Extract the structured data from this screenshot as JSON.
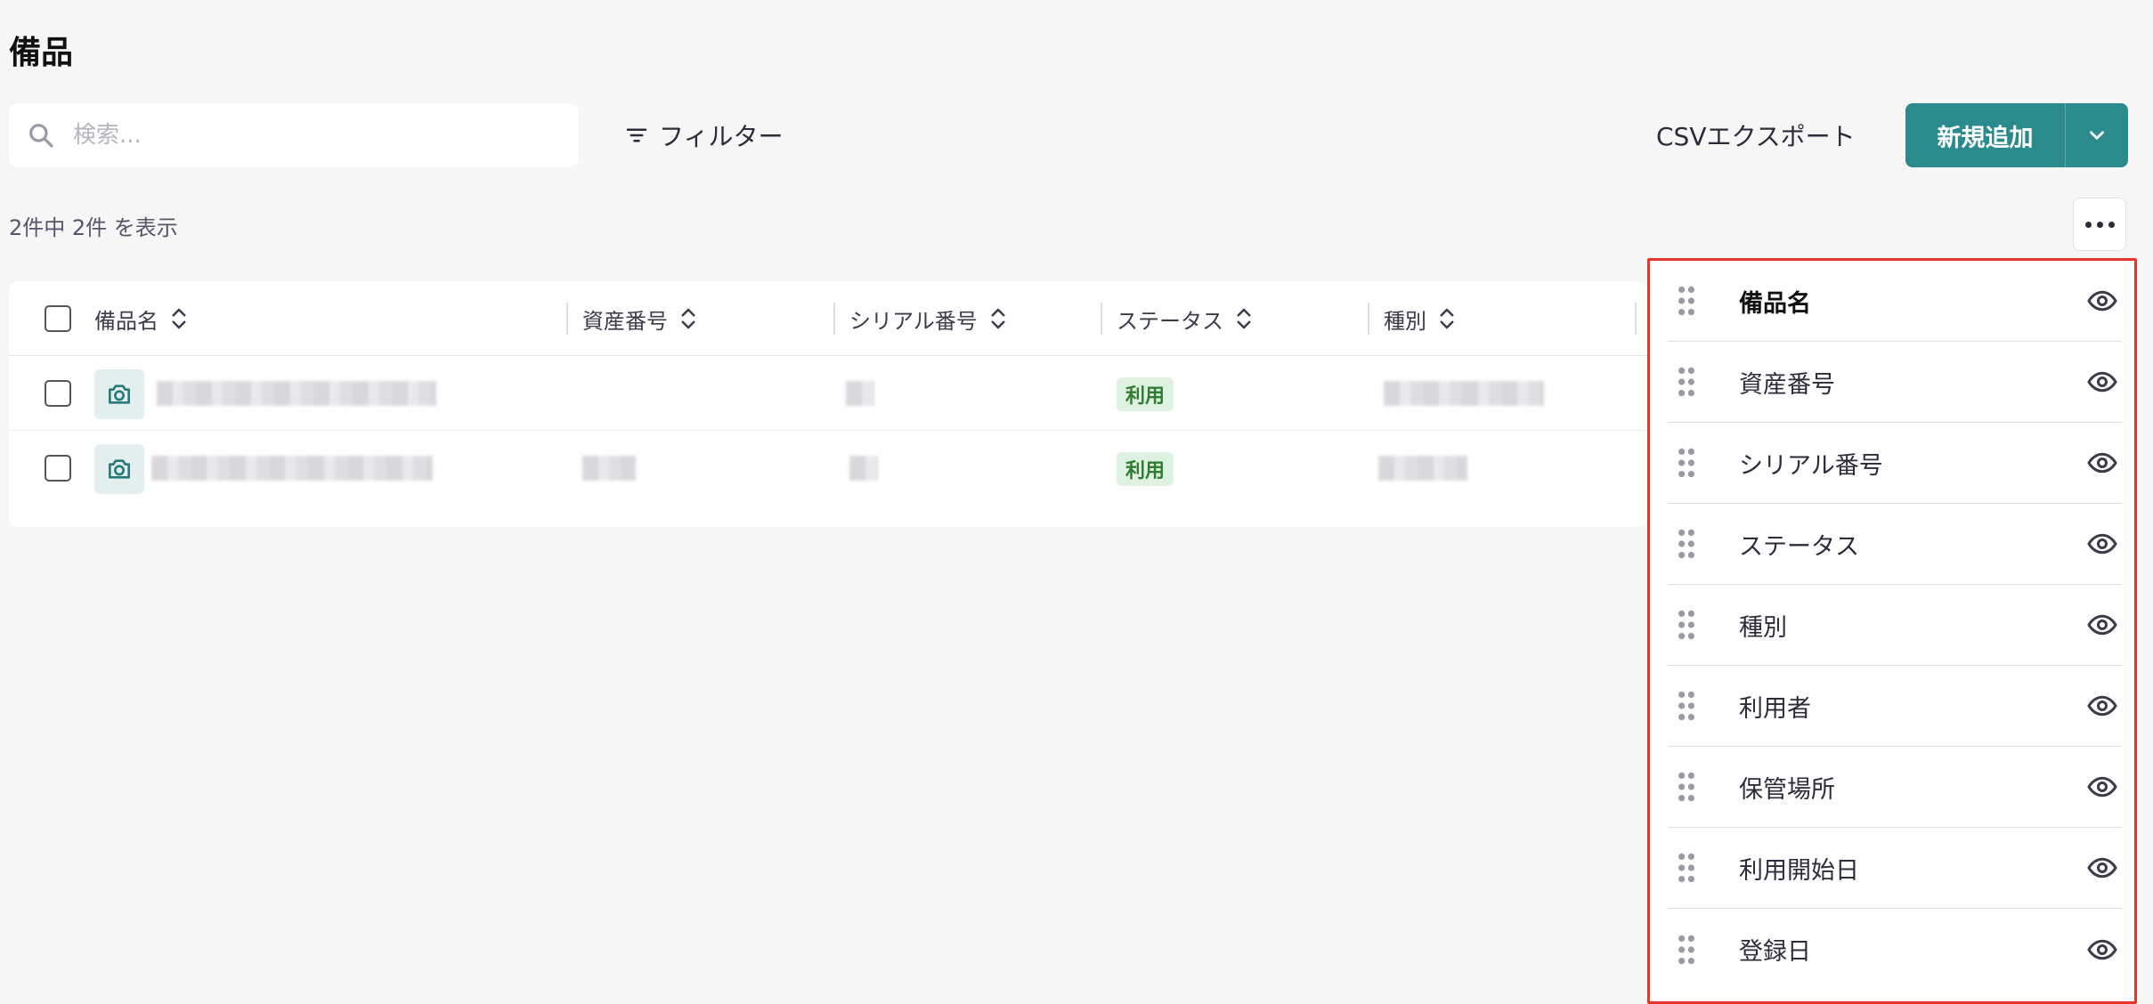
{
  "page": {
    "title": "備品"
  },
  "toolbar": {
    "search_placeholder": "検索...",
    "search_value": "",
    "filter_label": "フィルター",
    "csv_label": "CSVエクスポート",
    "add_label": "新規追加"
  },
  "count_text": "2件中 2件 を表示",
  "table": {
    "columns": [
      "備品名",
      "資産番号",
      "シリアル番号",
      "ステータス",
      "種別"
    ],
    "rows": [
      {
        "status": "利用"
      },
      {
        "status": "利用"
      }
    ]
  },
  "column_panel": {
    "items": [
      {
        "label": "備品名",
        "icon": "eye-icon"
      },
      {
        "label": "資産番号",
        "icon": "eye-icon"
      },
      {
        "label": "シリアル番号",
        "icon": "eye-icon"
      },
      {
        "label": "ステータス",
        "icon": "eye-icon"
      },
      {
        "label": "種別",
        "icon": "eye-icon"
      },
      {
        "label": "利用者",
        "icon": "eye-icon"
      },
      {
        "label": "保管場所",
        "icon": "eye-icon"
      },
      {
        "label": "利用開始日",
        "icon": "eye-icon"
      },
      {
        "label": "登録日",
        "icon": "eye-icon"
      }
    ]
  },
  "colors": {
    "primary": "#2a8a8c",
    "status_bg": "#dff1e1",
    "status_text": "#2e7d32",
    "highlight_border": "#e5342a"
  }
}
